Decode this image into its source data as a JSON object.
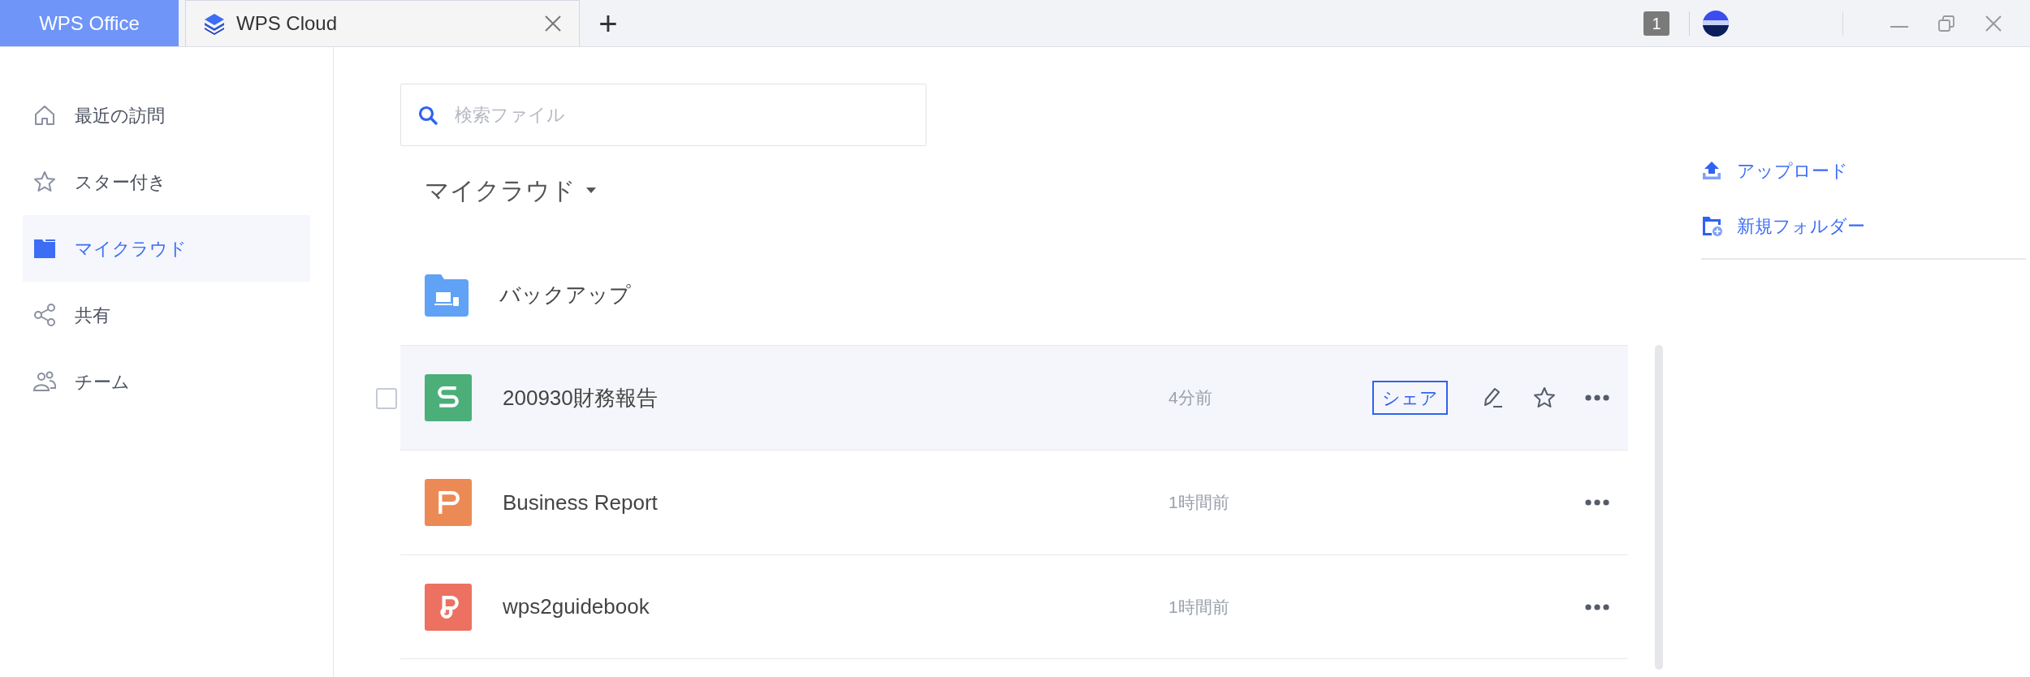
{
  "titlebar": {
    "tabs": [
      {
        "label": "WPS Office",
        "kind": "home",
        "selected": false
      },
      {
        "label": "WPS Cloud",
        "kind": "cloud",
        "selected": true
      }
    ],
    "new_tab": "+",
    "notification_count": "1"
  },
  "sidebar": {
    "items": [
      {
        "label": "最近の訪問",
        "kind": "home",
        "selected": false
      },
      {
        "label": "スター付き",
        "kind": "star",
        "selected": false
      },
      {
        "label": "マイクラウド",
        "kind": "folder",
        "selected": true
      },
      {
        "label": "共有",
        "kind": "share",
        "selected": false
      },
      {
        "label": "チーム",
        "kind": "team",
        "selected": false
      }
    ]
  },
  "search": {
    "placeholder": "検索ファイル"
  },
  "location": "マイクラウド",
  "folders": [
    {
      "name": "バックアップ"
    }
  ],
  "files": [
    {
      "name": "200930財務報告",
      "time": "4分前",
      "kind": "sheet",
      "selected": true,
      "checked": false,
      "share_label": "シェア"
    },
    {
      "name": "Business Report",
      "time": "1時間前",
      "kind": "slides",
      "selected": false,
      "checked": false
    },
    {
      "name": "wps2guidebook",
      "time": "1時間前",
      "kind": "pdf",
      "selected": false,
      "checked": false
    }
  ],
  "actions": [
    {
      "label": "アップロード",
      "kind": "upload"
    },
    {
      "label": "新規フォルダー",
      "kind": "new-folder"
    }
  ]
}
